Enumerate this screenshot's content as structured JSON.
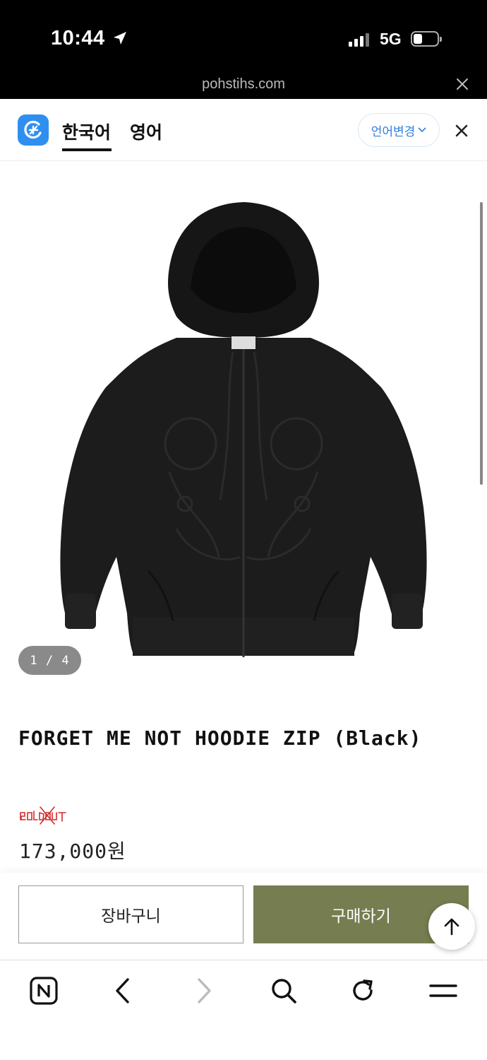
{
  "status_bar": {
    "time": "10:44",
    "network": "5G",
    "url": "pohstihs.com"
  },
  "translate_bar": {
    "tabs": [
      {
        "label": "한국어",
        "active": true
      },
      {
        "label": "영어",
        "active": false
      }
    ],
    "change_language_label": "언어변경",
    "accent_color": "#2e8ff0"
  },
  "gallery": {
    "current": "1",
    "separator": "/",
    "total": "4",
    "pager_text": "1 / 4"
  },
  "product": {
    "title": "FORGET ME NOT HOODIE ZIP (Black)",
    "sold_out_label": "SOLD OUT",
    "price": "173,000원"
  },
  "actions": {
    "cart_label": "장바구니",
    "buy_label": "구매하기",
    "buy_color": "#767d50"
  },
  "toolbar": {
    "icons": [
      "naver-home-icon",
      "back-icon",
      "forward-icon",
      "search-icon",
      "refresh-icon",
      "menu-icon"
    ]
  }
}
